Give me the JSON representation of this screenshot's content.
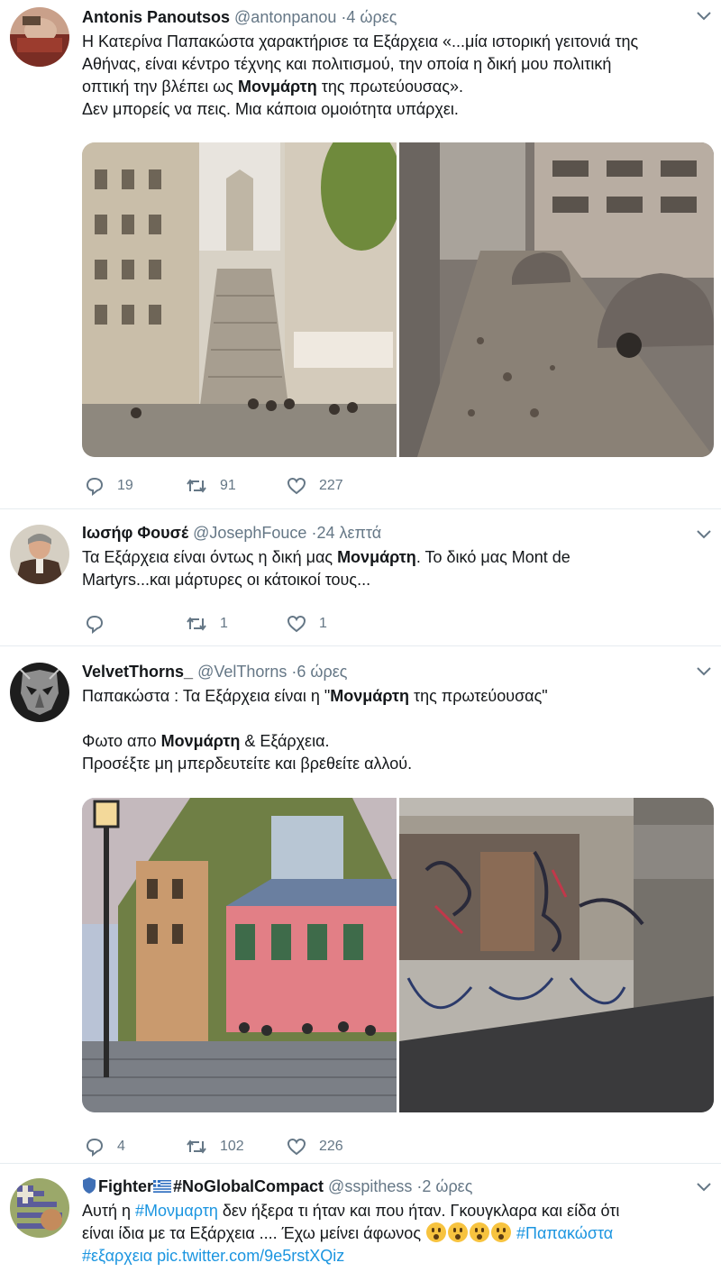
{
  "tweets": [
    {
      "name": "Antonis Panoutsos",
      "handle": "@antonpanou",
      "time": "4 ώρες",
      "text": {
        "l1": "Η Κατερίνα Παπακώστα χαρακτήρισε τα Εξάρχεια «...μία ιστορική γειτονιά της",
        "l2": "Αθήνας, είναι κέντρο τέχνης και πολιτισμού, την οποία η δική μου πολιτική",
        "l3a": "οπτική την βλέπει ως ",
        "l3b": "Μονμάρτη",
        "l3c": " της πρωτεύουσας».",
        "l4": "Δεν μπορείς να πεις. Μια κάποια ομοιότητα υπάρχει."
      },
      "replies": "19",
      "retweets": "91",
      "likes": "227"
    },
    {
      "name": "Ιωσήφ Φουσέ",
      "handle": "@JosephFouce",
      "time": "24 λεπτά",
      "text": {
        "l1a": "Τα Εξάρχεια είναι όντως η δική μας ",
        "l1b": "Μονμάρτη",
        "l1c": ". Το δικό μας Mont de",
        "l2": "Martyrs...και μάρτυρες οι κάτοικοί τους..."
      },
      "replies": "",
      "retweets": "1",
      "likes": "1"
    },
    {
      "name": "VelvetThorns_",
      "handle": "@VelThorns",
      "time": "6 ώρες",
      "text": {
        "l1a": "Παπακώστα : Τα Εξάρχεια είναι η \"",
        "l1b": "Μονμάρτη",
        "l1c": " της πρωτεύουσας\"",
        "l2a": "Φωτο απο ",
        "l2b": "Μονμάρτη",
        "l2c": " & Εξάρχεια.",
        "l3": "Προσέξτε μη μπερδευτείτε και βρεθείτε αλλού."
      },
      "replies": "4",
      "retweets": "102",
      "likes": "226"
    },
    {
      "name": "Fighter",
      "name_suffix": "#NoGlobalCompact",
      "handle": "@sspithess",
      "time": "2 ώρες",
      "text": {
        "l1a": "Αυτή η ",
        "l1b": "#Μονμαρτη",
        "l1c": " δεν ήξερα τι ήταν και που ήταν. Γκουγκλαρα και είδα ότι",
        "l2a": "είναι ίδια με τα Εξάρχεια .... Έχω μείνει άφωνος ",
        "l2b": "#Παπακώστα",
        "l3a": "#εξαρχεια",
        "l3b": "pic.twitter.com/9e5rstXQiz"
      }
    }
  ],
  "colors": {
    "text": "#14171a",
    "secondary": "#657786",
    "link": "#1b95e0",
    "divider": "#e6ecf0"
  },
  "separator": "·"
}
